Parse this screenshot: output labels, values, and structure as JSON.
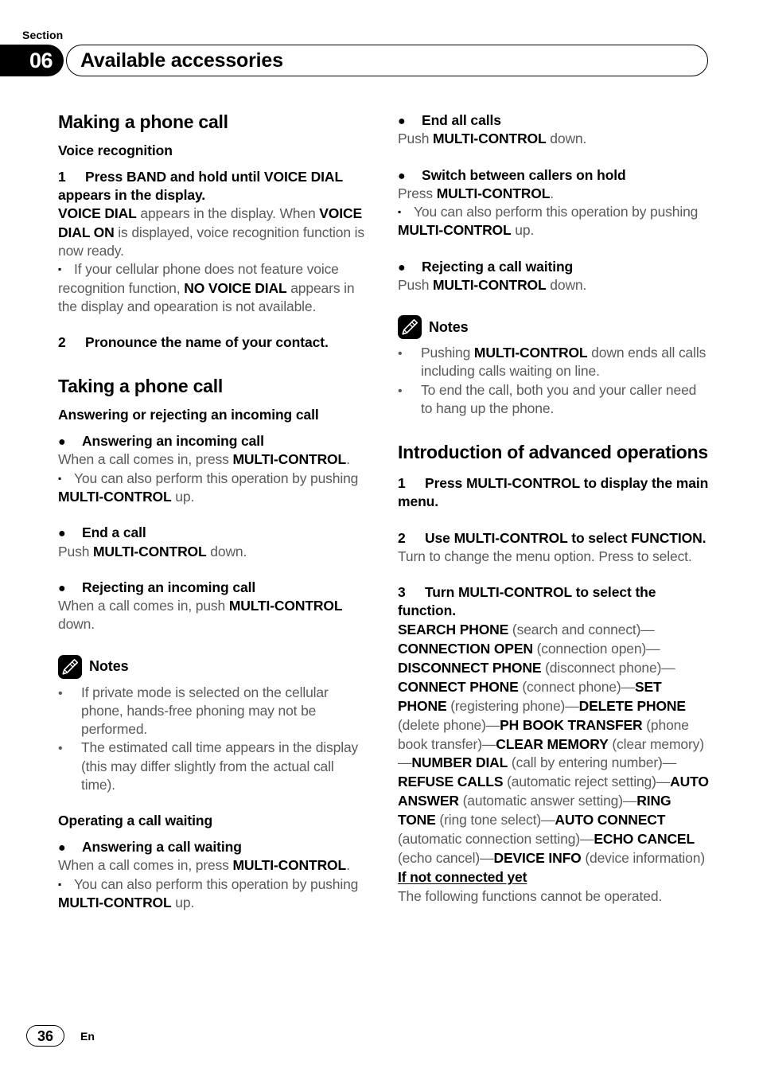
{
  "header": {
    "section_label": "Section",
    "section_number": "06",
    "title": "Available accessories"
  },
  "footer": {
    "page_number": "36",
    "language": "En"
  },
  "left_column": {
    "heading_making": "Making a phone call",
    "sub_voice_recognition": "Voice recognition",
    "step1_num": "1",
    "step1_text": "Press BAND and hold until VOICE DIAL appears in the display.",
    "step1_body_a": "VOICE DIAL",
    "step1_body_b": " appears in the display. When ",
    "step1_body_c": "VOICE DIAL ON",
    "step1_body_d": " is displayed, voice recognition function is now ready.",
    "note_voice_a": "If your cellular phone does not feature voice recognition function, ",
    "note_voice_b": "NO VOICE DIAL",
    "note_voice_c": " appears in the display and opearation is not available.",
    "step2_num": "2",
    "step2_text": "Pronounce the name of your contact.",
    "heading_taking": "Taking a phone call",
    "sub_answering_rejecting": "Answering or rejecting an incoming call",
    "b1_title": "Answering an incoming call",
    "b1_body_a": "When a call comes in, press ",
    "b1_body_b": "MULTI-CONTROL",
    "b1_body_c": ".",
    "b1_sub_a": "You can also perform this operation by pushing ",
    "b1_sub_b": "MULTI-CONTROL",
    "b1_sub_c": " up.",
    "b2_title": "End a call",
    "b2_body_a": "Push ",
    "b2_body_b": "MULTI-CONTROL",
    "b2_body_c": " down.",
    "b3_title": "Rejecting an incoming call",
    "b3_body_a": "When a call comes in, push ",
    "b3_body_b": "MULTI-CONTROL",
    "b3_body_c": " down.",
    "notes_title": "Notes",
    "note1": "If private mode is selected on the cellular phone, hands-free phoning may not be performed.",
    "note2": "The estimated call time appears in the display (this may differ slightly from the actual call time).",
    "sub_operating_call_waiting": "Operating a call waiting",
    "b4_title": "Answering a call waiting",
    "b4_body_a": "When a call comes in, press ",
    "b4_body_b": "MULTI-CONTROL",
    "b4_body_c": ".",
    "b4_sub_a": "You can also perform this operation by pushing ",
    "b4_sub_b": "MULTI-CONTROL",
    "b4_sub_c": " up."
  },
  "right_column": {
    "b5_title": "End all calls",
    "b5_body_a": "Push ",
    "b5_body_b": "MULTI-CONTROL",
    "b5_body_c": " down.",
    "b6_title": "Switch between callers on hold",
    "b6_body_a": "Press ",
    "b6_body_b": "MULTI-CONTROL",
    "b6_body_c": ".",
    "b6_sub_a": "You can also perform this operation by pushing ",
    "b6_sub_b": "MULTI-CONTROL",
    "b6_sub_c": " up.",
    "b7_title": "Rejecting a call waiting",
    "b7_body_a": "Push ",
    "b7_body_b": "MULTI-CONTROL",
    "b7_body_c": " down.",
    "notes_title": "Notes",
    "note1_a": "Pushing ",
    "note1_b": "MULTI-CONTROL",
    "note1_c": " down ends all calls including calls waiting on line.",
    "note2": "To end the call, both you and your caller need to hang up the phone.",
    "heading_intro": "Introduction of advanced operations",
    "step1_num": "1",
    "step1_text": "Press MULTI-CONTROL to display the main menu.",
    "step2_num": "2",
    "step2_text": "Use MULTI-CONTROL to select FUNCTION.",
    "step2_body": "Turn to change the menu option. Press to select.",
    "step3_num": "3",
    "step3_text": "Turn MULTI-CONTROL to select the function.",
    "functions": [
      {
        "name": "SEARCH PHONE",
        "desc": "(search and connect)",
        "sep": "—"
      },
      {
        "name": "CONNECTION OPEN",
        "desc": "(connection open)",
        "sep": "—"
      },
      {
        "name": "DISCONNECT PHONE",
        "desc": "(disconnect phone)",
        "sep": "—"
      },
      {
        "name": "CONNECT PHONE",
        "desc": "(connect phone)",
        "sep": "—"
      },
      {
        "name": "SET PHONE",
        "desc": "(registering phone)",
        "sep": "—"
      },
      {
        "name": "DELETE PHONE",
        "desc": "(delete phone)",
        "sep": "—"
      },
      {
        "name": "PH BOOK TRANSFER",
        "desc": "(phone book transfer)",
        "sep": "—"
      },
      {
        "name": "CLEAR MEMORY",
        "desc": "(clear memory)",
        "sep": "—"
      },
      {
        "name": "NUMBER DIAL",
        "desc": "(call by entering number)",
        "sep": "—"
      },
      {
        "name": "REFUSE CALLS",
        "desc": "(automatic reject setting)",
        "sep": "—"
      },
      {
        "name": "AUTO ANSWER",
        "desc": "(automatic answer setting)",
        "sep": "—"
      },
      {
        "name": "RING TONE",
        "desc": "(ring tone select)",
        "sep": "—"
      },
      {
        "name": "AUTO CONNECT",
        "desc": "(automatic connection setting)",
        "sep": "—"
      },
      {
        "name": "ECHO CANCEL",
        "desc": "(echo cancel)",
        "sep": "—"
      },
      {
        "name": "DEVICE INFO",
        "desc": "(device information)",
        "sep": ""
      }
    ],
    "if_not_connected": "If not connected yet",
    "if_not_connected_body": "The following functions cannot be operated."
  },
  "glyphs": {
    "bullet_dot": "●",
    "bullet_square": "▪",
    "note_dot": "•"
  }
}
